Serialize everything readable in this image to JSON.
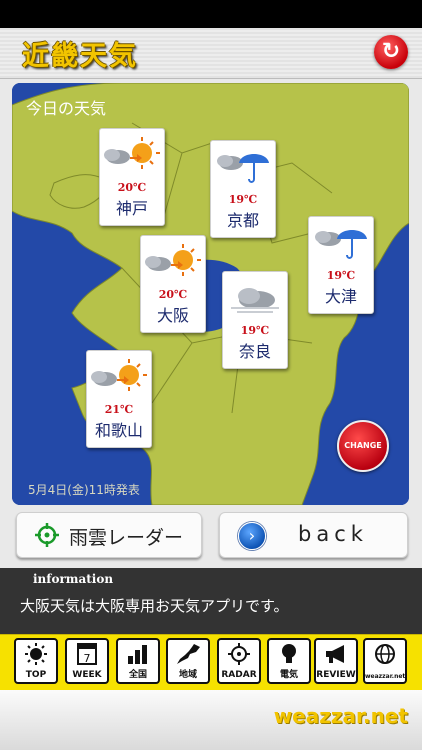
{
  "header": {
    "title": "近畿天気"
  },
  "map": {
    "heading": "今日の天気",
    "footer": "5月4日(金)11時発表",
    "change_label": "CHANGE",
    "colors": {
      "land": "#b6c24a",
      "sea": "#2349a8"
    },
    "cities": [
      {
        "name": "神戸",
        "temp": "20℃",
        "icon": "cloudy-then-sunny-icon"
      },
      {
        "name": "京都",
        "temp": "19℃",
        "icon": "cloudy-rain-umbrella-icon"
      },
      {
        "name": "大阪",
        "temp": "20℃",
        "icon": "cloudy-then-sunny-icon"
      },
      {
        "name": "大津",
        "temp": "19℃",
        "icon": "cloudy-rain-umbrella-icon"
      },
      {
        "name": "奈良",
        "temp": "19℃",
        "icon": "cloudy-icon"
      },
      {
        "name": "和歌山",
        "temp": "21℃",
        "icon": "cloudy-then-sunny-icon"
      }
    ]
  },
  "buttons": {
    "radar": "雨雲レーダー",
    "back": "back"
  },
  "info": {
    "heading": "information",
    "text": "大阪天気は大阪専用お天気アプリです。"
  },
  "toolbar": {
    "items": [
      {
        "label": "TOP",
        "icon": "sun-icon"
      },
      {
        "label": "WEEK",
        "icon": "calendar-icon",
        "badge": "7"
      },
      {
        "label": "全国",
        "icon": "bar-chart-icon"
      },
      {
        "label": "地域",
        "icon": "japan-map-icon"
      },
      {
        "label": "RADAR",
        "icon": "crosshair-icon"
      },
      {
        "label": "電気",
        "icon": "bulb-icon"
      },
      {
        "label": "REVIEW",
        "icon": "megaphone-icon"
      },
      {
        "label": "weazzar.net",
        "icon": "globe-icon"
      }
    ]
  },
  "brand": "weazzar.net"
}
